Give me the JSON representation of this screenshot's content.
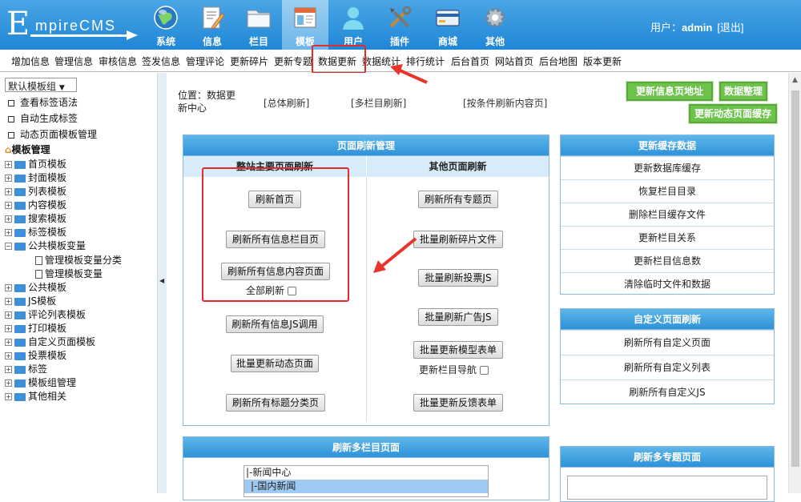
{
  "logo": {
    "first": "E",
    "rest": "mpireCMS"
  },
  "topnav": [
    {
      "label": "系统",
      "icon": "globe-icon"
    },
    {
      "label": "信息",
      "icon": "document-pencil-icon"
    },
    {
      "label": "栏目",
      "icon": "folder-icon"
    },
    {
      "label": "模板",
      "icon": "template-window-icon"
    },
    {
      "label": "用户",
      "icon": "user-icon"
    },
    {
      "label": "插件",
      "icon": "tools-icon"
    },
    {
      "label": "商城",
      "icon": "credit-card-icon"
    },
    {
      "label": "其他",
      "icon": "gear-icon"
    }
  ],
  "user": {
    "prefix": "用户：",
    "name": "admin",
    "logout": "[退出]"
  },
  "subnav": [
    "增加信息",
    "管理信息",
    "审核信息",
    "签发信息",
    "管理评论",
    "更新碎片",
    "更新专题",
    "数据更新",
    "数据统计",
    "排行统计",
    "后台首页",
    "网站首页",
    "后台地图",
    "版本更新"
  ],
  "sidebar": {
    "select": "默认模板组",
    "quick": [
      "查看标签语法",
      "自动生成标签",
      "动态页面模板管理"
    ],
    "root": "模板管理",
    "items": [
      "首页模板",
      "封面模板",
      "列表模板",
      "内容模板",
      "搜索模板",
      "标签模板",
      "公共模板变量"
    ],
    "sub": [
      "管理模板变量分类",
      "管理模板变量"
    ],
    "items2": [
      "公共模板",
      "JS模板",
      "评论列表模板",
      "打印模板",
      "自定义页面模板",
      "投票模板",
      "标签",
      "模板组管理",
      "其他相关"
    ]
  },
  "main": {
    "location": "位置：数据更新中心",
    "links": [
      "[总体刷新]",
      "[多栏目刷新]",
      "[按条件刷新内容页]"
    ],
    "top_buttons": [
      "更新信息页地址",
      "数据整理",
      "更新动态页面缓存"
    ],
    "page_refresh": {
      "title": "页面刷新管理",
      "left_header": "整站主要页面刷新",
      "right_header": "其他页面刷新",
      "left_buttons": [
        "刷新首页",
        "刷新所有信息栏目页",
        "刷新所有信息内容页面",
        "刷新所有信息JS调用",
        "批量更新动态页面",
        "刷新所有标题分类页"
      ],
      "all_refresh": "全部刷新",
      "right_buttons": [
        "刷新所有专题页",
        "批量刷新碎片文件",
        "批量刷新投票JS",
        "批量刷新广告JS",
        "批量更新模型表单",
        "批量更新反馈表单"
      ],
      "update_nav": "更新栏目导航"
    },
    "cache": {
      "title": "更新缓存数据",
      "rows": [
        "更新数据库缓存",
        "恢复栏目目录",
        "删除栏目缓存文件",
        "更新栏目关系",
        "更新栏目信息数",
        "清除临时文件和数据"
      ]
    },
    "custom": {
      "title": "自定义页面刷新",
      "rows": [
        "刷新所有自定义页面",
        "刷新所有自定义列表",
        "刷新所有自定义JS"
      ]
    },
    "multi_column": {
      "title": "刷新多栏目页面",
      "options": [
        "|-新闻中心",
        "|-国内新闻"
      ]
    },
    "multi_special": {
      "title": "刷新多专题页面"
    }
  },
  "colors": {
    "accent": "#2e93d8",
    "green": "#6cc24a",
    "highlight": "#e52a2a"
  }
}
